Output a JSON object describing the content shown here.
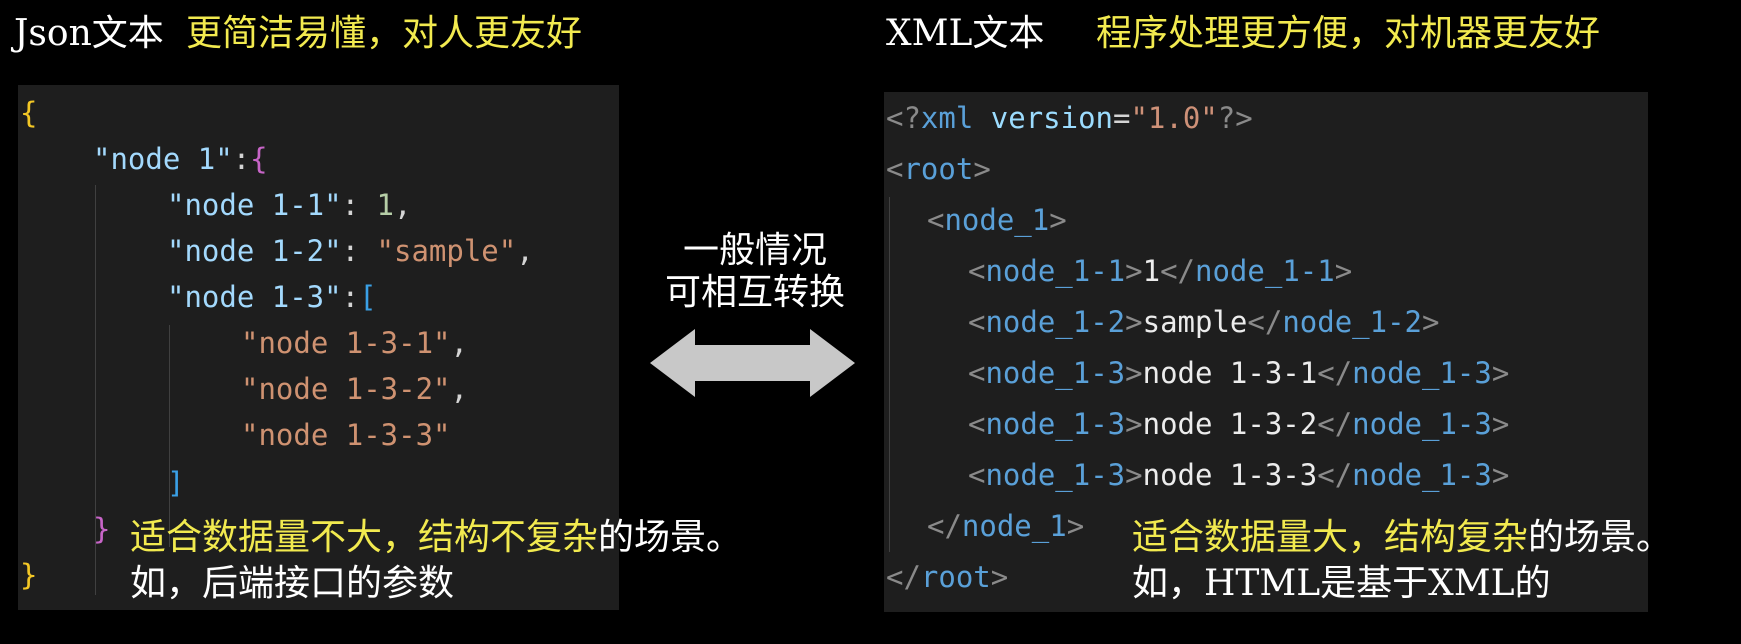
{
  "left": {
    "title": "Json文本",
    "tagline": "更简洁易懂，对人更友好",
    "code": {
      "open_brace": "{",
      "node1_key": "\"node 1\"",
      "colon": ":",
      "node1_open": "{",
      "n11_key": "\"node 1-1\"",
      "n11_sep": ": ",
      "n11_val": "1",
      "n11_comma": ",",
      "n12_key": "\"node 1-2\"",
      "n12_sep": ": ",
      "n12_val": "\"sample\"",
      "n12_comma": ",",
      "n13_key": "\"node 1-3\"",
      "n13_sep": ":",
      "n13_open": "[",
      "n131": "\"node 1-3-1\"",
      "n131_comma": ",",
      "n132": "\"node 1-3-2\"",
      "n132_comma": ",",
      "n133": "\"node 1-3-3\"",
      "n13_close": "]",
      "node1_close": "}",
      "close_brace": "}"
    },
    "note_yellow_1": "适合数据量不大，结构不复杂",
    "note_white_1": "的场景。",
    "note_sub": "如，后端接口的参数"
  },
  "middle": {
    "line1": "一般情况",
    "line2": "可相互转换"
  },
  "right": {
    "title": "XML文本",
    "tagline": "程序处理更方便，对机器更友好",
    "code": {
      "decl_open": "<?",
      "decl_name": "xml",
      "decl_attr": "version",
      "decl_eq": "=",
      "decl_val": "\"1.0\"",
      "decl_close": "?>",
      "lt": "<",
      "gt": ">",
      "lt_slash": "</",
      "root": "root",
      "node_1": "node_1",
      "node_1_1": "node_1-1",
      "node_1_1_val": "1",
      "node_1_2": "node_1-2",
      "node_1_2_val": "sample",
      "node_1_3": "node_1-3",
      "node_1_3_val1": "node 1-3-1",
      "node_1_3_val2": "node 1-3-2",
      "node_1_3_val3": "node 1-3-3"
    },
    "note_yellow_a": "适合数据量大，结构复杂",
    "note_white_1": "的场景。",
    "note_sub": "如，HTML是基于XML的"
  },
  "colors": {
    "background": "#000000",
    "panel": "#1e1e1e",
    "yellow_text": "#f2ea4f",
    "arrow": "#c8c8c8"
  }
}
